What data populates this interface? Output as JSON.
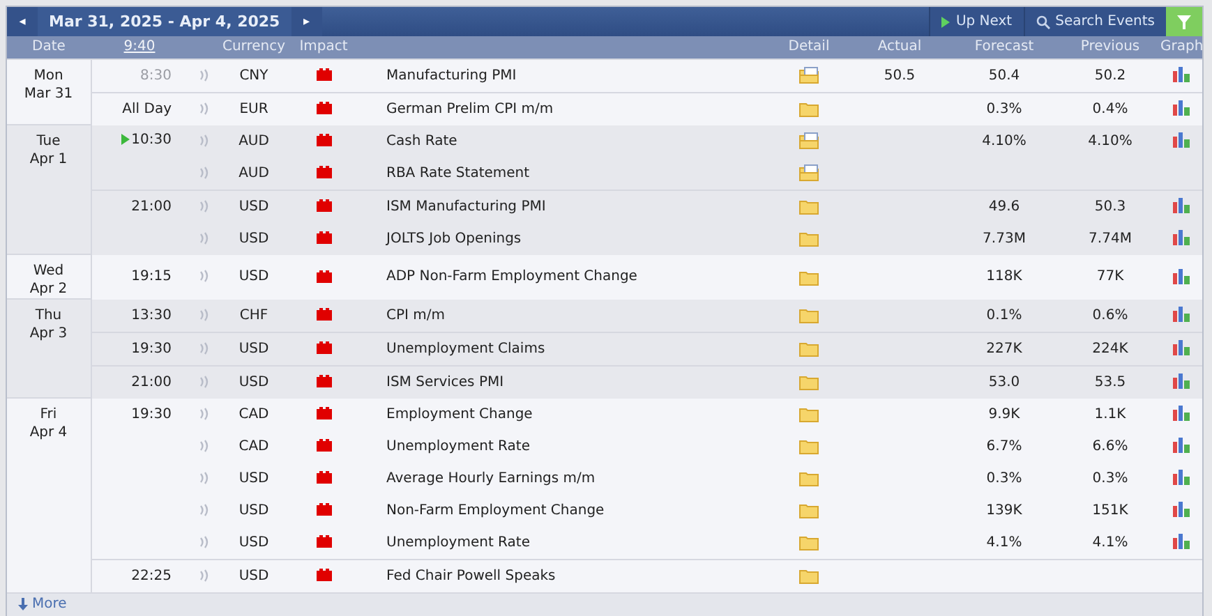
{
  "toolbar": {
    "prev": "◂",
    "range": "Mar 31, 2025 - Apr 4, 2025",
    "next": "▸",
    "up_next": "Up Next",
    "search": "Search Events"
  },
  "columns": {
    "date": "Date",
    "time": "9:40",
    "currency": "Currency",
    "impact": "Impact",
    "detail": "Detail",
    "actual": "Actual",
    "forecast": "Forecast",
    "previous": "Previous",
    "graph": "Graph"
  },
  "days": [
    {
      "day": "Mon",
      "date": "Mar 31",
      "events": [
        {
          "time": "8:30",
          "past": true,
          "currency": "CNY",
          "color": "#e00000",
          "event": "Manufacturing PMI",
          "kind": "document",
          "actual": "50.5",
          "forecast": "50.4",
          "previous": "50.2",
          "graph": true
        },
        {
          "time": "All Day",
          "currency": "EUR",
          "color": "#e00000",
          "event": "German Prelim CPI m/m",
          "kind": "folder",
          "forecast": "0.3%",
          "previous": "0.4%",
          "graph": true
        }
      ]
    },
    {
      "day": "Tue",
      "date": "Apr 1",
      "events": [
        {
          "time": "10:30",
          "next": true,
          "currency": "AUD",
          "color": "#e00000",
          "event": "Cash Rate",
          "kind": "document",
          "forecast": "4.10%",
          "previous": "4.10%",
          "graph": true
        },
        {
          "currency": "AUD",
          "color": "#e00000",
          "event": "RBA Rate Statement",
          "kind": "document",
          "graph": false
        },
        {
          "time": "21:00",
          "currency": "USD",
          "color": "#e00000",
          "event": "ISM Manufacturing PMI",
          "kind": "folder",
          "forecast": "49.6",
          "previous": "50.3",
          "graph": true
        },
        {
          "currency": "USD",
          "color": "#e00000",
          "event": "JOLTS Job Openings",
          "kind": "folder",
          "forecast": "7.73M",
          "previous": "7.74M",
          "graph": true
        }
      ]
    },
    {
      "day": "Wed",
      "date": "Apr 2",
      "events": [
        {
          "time": "19:15",
          "currency": "USD",
          "color": "#e00000",
          "event": "ADP Non-Farm Employment Change",
          "kind": "folder",
          "forecast": "118K",
          "previous": "77K",
          "graph": true
        }
      ]
    },
    {
      "day": "Thu",
      "date": "Apr 3",
      "events": [
        {
          "time": "13:30",
          "currency": "CHF",
          "color": "#e00000",
          "event": "CPI m/m",
          "kind": "folder",
          "forecast": "0.1%",
          "previous": "0.6%",
          "graph": true
        },
        {
          "time": "19:30",
          "currency": "USD",
          "color": "#e00000",
          "event": "Unemployment Claims",
          "kind": "folder",
          "forecast": "227K",
          "previous": "224K",
          "graph": true
        },
        {
          "time": "21:00",
          "currency": "USD",
          "color": "#e00000",
          "event": "ISM Services PMI",
          "kind": "folder",
          "forecast": "53.0",
          "previous": "53.5",
          "graph": true
        }
      ]
    },
    {
      "day": "Fri",
      "date": "Apr 4",
      "events": [
        {
          "time": "19:30",
          "currency": "CAD",
          "color": "#e00000",
          "event": "Employment Change",
          "kind": "folder",
          "forecast": "9.9K",
          "previous": "1.1K",
          "graph": true
        },
        {
          "currency": "CAD",
          "color": "#e00000",
          "event": "Unemployment Rate",
          "kind": "folder",
          "forecast": "6.7%",
          "previous": "6.6%",
          "graph": true
        },
        {
          "currency": "USD",
          "color": "#e00000",
          "event": "Average Hourly Earnings m/m",
          "kind": "folder",
          "forecast": "0.3%",
          "previous": "0.3%",
          "graph": true
        },
        {
          "currency": "USD",
          "color": "#e00000",
          "event": "Non-Farm Employment Change",
          "kind": "folder",
          "forecast": "139K",
          "previous": "151K",
          "graph": true
        },
        {
          "currency": "USD",
          "color": "#e00000",
          "event": "Unemployment Rate",
          "kind": "folder",
          "forecast": "4.1%",
          "previous": "4.1%",
          "graph": true
        },
        {
          "time": "22:25",
          "currency": "USD",
          "color": "#e00000",
          "event": "Fed Chair Powell Speaks",
          "kind": "folder",
          "graph": false
        }
      ]
    }
  ],
  "more": "More"
}
